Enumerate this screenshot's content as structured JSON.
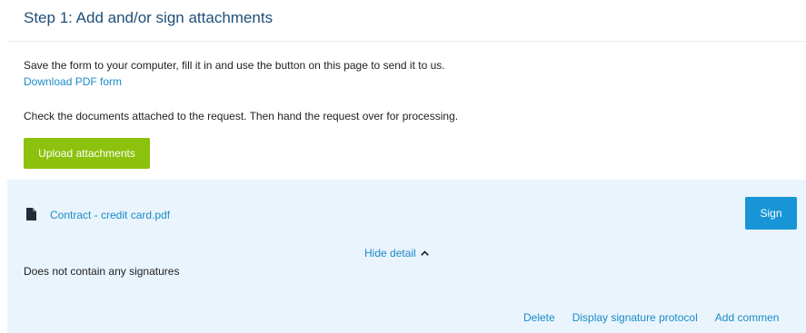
{
  "step": {
    "title": "Step 1: Add and/or sign attachments"
  },
  "instructions": {
    "text": "Save the form to your computer, fill it in and use the button on this page to send it to us.",
    "download_link": "Download PDF form",
    "check_text": "Check the documents attached to the request. Then hand the request over for processing."
  },
  "upload_button": {
    "label": "Upload attachments",
    "color": "#8cc10d"
  },
  "attachment": {
    "file_icon": "file-icon",
    "file_name": "Contract - credit card.pdf",
    "sign_label": "Sign",
    "sign_color": "#1795d6",
    "hide_detail_label": "Hide detail",
    "hide_detail_icon": "chevron-up-icon",
    "signature_status": "Does not contain any signatures",
    "actions": {
      "delete": "Delete",
      "display_protocol": "Display signature protocol",
      "add_comment": "Add commen"
    }
  },
  "colors": {
    "title": "#1f4e79",
    "link": "#1a8bc8",
    "panel_background": "#eaf4fc"
  }
}
